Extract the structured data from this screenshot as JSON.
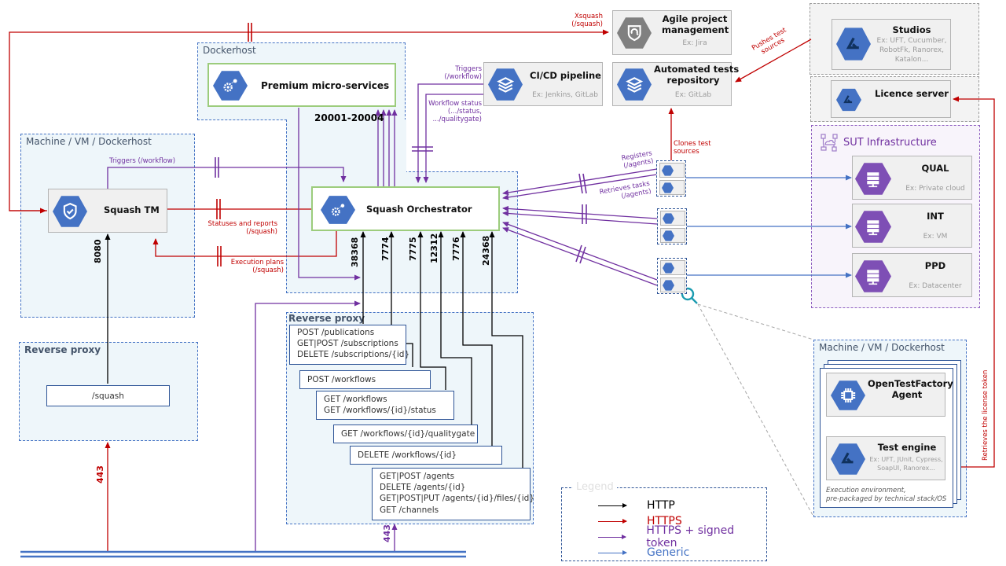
{
  "zones": {
    "dockerhost_top": "Dockerhost",
    "machine_squash_tm": "Machine / VM / Dockerhost",
    "reverse_proxy_left": "Reverse proxy",
    "reverse_proxy_center": "Reverse proxy",
    "sut_infrastructure": "SUT Infrastructure",
    "machine_agent": "Machine / VM / Dockerhost"
  },
  "nodes": {
    "premium": {
      "title": "Premium micro-services",
      "icon": "gears-icon"
    },
    "orchestrator": {
      "title": "Squash Orchestrator",
      "icon": "gears-icon"
    },
    "squash_tm": {
      "title": "Squash TM",
      "icon": "shield-check-icon"
    },
    "agile": {
      "title": "Agile project management",
      "title_lines": [
        "Agile project",
        "management"
      ],
      "sub": "Ex: Jira",
      "icon": "cycle-badge-icon"
    },
    "cicd": {
      "title": "CI/CD pipeline",
      "sub": "Ex: Jenkins, GitLab",
      "icon": "layers-icon"
    },
    "repo": {
      "title_lines": [
        "Automated tests",
        "repository"
      ],
      "sub": "Ex: GitLab",
      "icon": "layers-icon"
    },
    "studios": {
      "title": "Studios",
      "sub_lines": [
        "Ex: UFT, Cucumber,",
        "RobotFk, Ranorex,",
        "Katalon..."
      ],
      "icon": "triangle-logo-icon"
    },
    "licence": {
      "title": "Licence server",
      "icon": "triangle-logo-icon"
    },
    "qual": {
      "title": "QUAL",
      "sub": "Ex: Private cloud",
      "icon": "server-icon"
    },
    "int": {
      "title": "INT",
      "sub": "Ex: VM",
      "icon": "server-icon"
    },
    "ppd": {
      "title": "PPD",
      "sub": "Ex: Datacenter",
      "icon": "server-icon"
    },
    "otf_agent": {
      "title_lines": [
        "OpenTestFactory",
        "Agent"
      ],
      "icon": "chip-icon"
    },
    "test_engine": {
      "title": "Test engine",
      "sub_lines": [
        "Ex: UFT, JUnit, Cypress,",
        "SoapUI, Ranorex..."
      ],
      "icon": "triangle-logo-icon"
    },
    "exec_env_note": [
      "Execution environment,",
      "pre-packaged by technical stack/OS"
    ]
  },
  "routes": {
    "squash": "/squash",
    "publications": [
      "POST /publications",
      "GET|POST /subscriptions",
      "DELETE /subscriptions/{id}"
    ],
    "post_workflows": [
      "POST /workflows"
    ],
    "get_workflows": [
      "GET /workflows",
      "GET /workflows/{id}/status"
    ],
    "qualitygate": [
      "GET /workflows/{id}/qualitygate"
    ],
    "delete_workflows": [
      "DELETE /workflows/{id}"
    ],
    "agents": [
      "GET|POST /agents",
      "DELETE /agents/{id}",
      "GET|POST|PUT /agents/{id}/files/{id}",
      "GET /channels"
    ]
  },
  "ports": {
    "premium_range": "20001-20004",
    "squash_tm": "8080",
    "orchestrator": [
      "38368",
      "7774",
      "7775",
      "12312",
      "7776",
      "24368"
    ],
    "proxy_left": "443",
    "proxy_center": "443"
  },
  "labels": {
    "xsquash": [
      "Xsquash",
      "(/squash)"
    ],
    "triggers_tm": "Triggers (/workflow)",
    "statuses_reports": [
      "Statuses and reports",
      "(/squash)"
    ],
    "execution_plans": [
      "Execution plans",
      "(/squash)"
    ],
    "triggers_cicd": [
      "Triggers",
      "(/workflow)"
    ],
    "workflow_status": [
      "Workflow status",
      "(.../status,",
      ".../qualitygate)"
    ],
    "clones_sources": [
      "Clones test",
      "sources"
    ],
    "pushes_sources": [
      "Pushes test",
      "sources"
    ],
    "registers": [
      "Registers",
      "(/agents)"
    ],
    "retrieves_tasks": [
      "Retrieves tasks",
      "(/agents)"
    ],
    "retrieves_license": "Retrieves the license token"
  },
  "legend": {
    "title": "Legend",
    "items": [
      {
        "label": "HTTP",
        "color": "#000000"
      },
      {
        "label": "HTTPS",
        "color": "#c00000"
      },
      {
        "label": "HTTPS + signed token",
        "color": "#7030a0"
      },
      {
        "label": "Generic",
        "color": "#4472c4"
      }
    ]
  },
  "colors": {
    "http": "#000000",
    "https": "#c00000",
    "signed": "#7030a0",
    "generic": "#4472c4",
    "icon_blue": "#4472c4",
    "icon_purple": "#7e4fb5",
    "zoom_teal": "#1a9bb0"
  }
}
